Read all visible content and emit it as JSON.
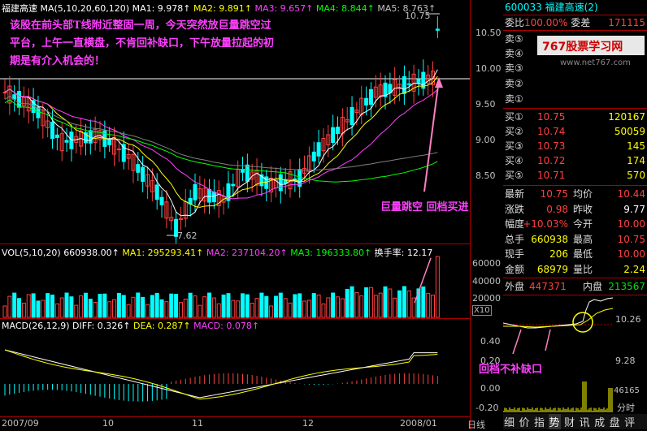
{
  "main_panel": {
    "title": "福建高速",
    "ma_label": "MA(5,10,20,60,120)",
    "ma": [
      {
        "label": "MA1: 9.978↑",
        "color": "#ffffff"
      },
      {
        "label": "MA2: 9.891↑",
        "color": "#ffff00"
      },
      {
        "label": "MA3: 9.657↑",
        "color": "#ff40ff"
      },
      {
        "label": "MA4: 8.844↑",
        "color": "#00ff00"
      },
      {
        "label": "MA5: 8.763↑",
        "color": "#c0c0c0"
      }
    ],
    "high_label": "10.75",
    "low_label": "7.62",
    "price_axis": [
      "10.50",
      "10.00",
      "9.50",
      "9.00",
      "8.50"
    ],
    "annotation_top": [
      "该股在前头部T线附近整固一周，今天突然放巨量跳空过",
      "平台，上午一直横盘，不肯回补缺口，下午放量拉起的初",
      "期是有介入机会的！"
    ],
    "annotation_gap": "巨量跳空  回档买进"
  },
  "vol_panel": {
    "label": "VOL(5,10,20)",
    "vol": "660938.00↑",
    "ma1": "MA1: 295293.41↑",
    "ma2": "MA2: 237104.20↑",
    "ma3": "MA3: 196333.80↑",
    "turnover": "换手率: 12.17",
    "axis": [
      "60000",
      "40000",
      "20000"
    ],
    "unit": "X10"
  },
  "macd_panel": {
    "label": "MACD(26,12,9)",
    "diff": "DIFF: 0.326↑",
    "dea": "DEA: 0.287↑",
    "macd": "MACD: 0.078↑",
    "axis": [
      "0.40",
      "0.20",
      "0.00",
      "-0.20"
    ]
  },
  "date_axis": [
    "2007/09",
    "10",
    "11",
    "12",
    "2008/01"
  ],
  "day_line_label": "日线",
  "quote": {
    "code_name": "600033 福建高速(2)",
    "weibi_label": "委比",
    "weibi": "100.00%",
    "weicha_label": "委差",
    "weicha": "171115",
    "sell": [
      {
        "label": "卖⑤",
        "price": "",
        "vol": ""
      },
      {
        "label": "卖④",
        "price": "",
        "vol": ""
      },
      {
        "label": "卖③",
        "price": "",
        "vol": ""
      },
      {
        "label": "卖②",
        "price": "",
        "vol": ""
      },
      {
        "label": "卖①",
        "price": "",
        "vol": ""
      }
    ],
    "buy": [
      {
        "label": "买①",
        "price": "10.75",
        "vol": "120167"
      },
      {
        "label": "买②",
        "price": "10.74",
        "vol": "50059"
      },
      {
        "label": "买③",
        "price": "10.73",
        "vol": "145"
      },
      {
        "label": "买④",
        "price": "10.72",
        "vol": "174"
      },
      {
        "label": "买⑤",
        "price": "10.71",
        "vol": "570"
      }
    ],
    "stats": [
      {
        "l1": "最新",
        "v1": "10.75",
        "c1": "#ff4040",
        "l2": "均价",
        "v2": "10.44",
        "c2": "#ff4040"
      },
      {
        "l1": "涨跌",
        "v1": "0.98",
        "c1": "#ff4040",
        "l2": "昨收",
        "v2": "9.77",
        "c2": "#ffffff"
      },
      {
        "l1": "幅度",
        "v1": "+10.03%",
        "c1": "#ff4040",
        "l2": "今开",
        "v2": "10.00",
        "c2": "#ff4040"
      },
      {
        "l1": "总手",
        "v1": "660938",
        "c1": "#ffff00",
        "l2": "最高",
        "v2": "10.75",
        "c2": "#ff4040"
      },
      {
        "l1": "现手",
        "v1": "206",
        "c1": "#ffff00",
        "l2": "最低",
        "v2": "10.00",
        "c2": "#ff4040"
      },
      {
        "l1": "金额",
        "v1": "68979",
        "c1": "#ffff00",
        "l2": "量比",
        "v2": "2.24",
        "c2": "#ffff00"
      }
    ],
    "waipan_label": "外盘",
    "waipan": "447371",
    "neipan_label": "内盘",
    "neipan": "213567",
    "watermark_title": "767股票学习网",
    "watermark_url": "www.net767.com"
  },
  "mini_chart": {
    "price_top": "10.26",
    "price_bottom": "9.28",
    "vol_label": "46165",
    "time_label": "分时",
    "annotation": "回档不补缺口"
  },
  "tabs": [
    "细",
    "价",
    "指",
    "势",
    "财",
    "讯",
    "成",
    "盘",
    "评"
  ]
}
